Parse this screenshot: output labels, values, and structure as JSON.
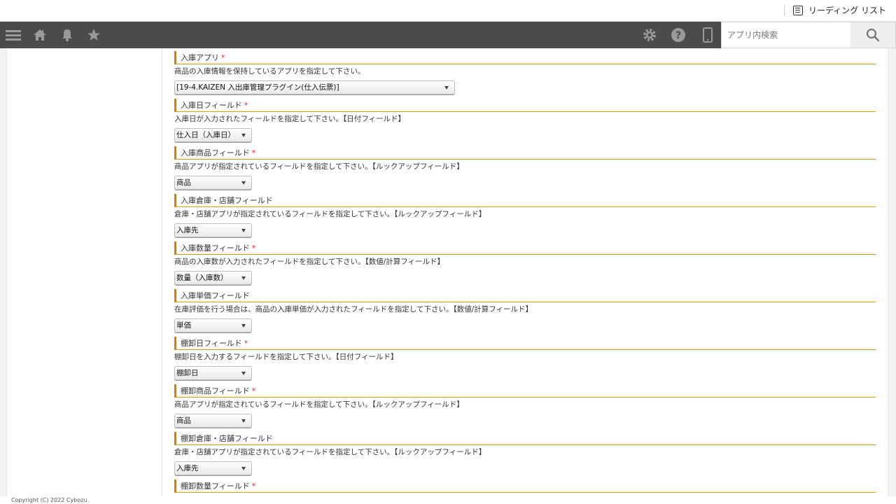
{
  "browser": {
    "reading_list_label": "リーディング リスト"
  },
  "header": {
    "search_placeholder": "アプリ内検索"
  },
  "sections": [
    {
      "title": "入庫アプリ",
      "required": "*",
      "desc": "商品の入庫情報を保持しているアプリを指定して下さい。",
      "value": "[19-4.KAIZEN 入出庫管理プラグイン(仕入伝票)]"
    },
    {
      "title": "入庫日フィールド",
      "required": "*",
      "desc": "入庫日が入力されたフィールドを指定して下さい。【日付フィールド】",
      "value": "仕入日（入庫日）"
    },
    {
      "title": "入庫商品フィールド",
      "required": "*",
      "desc": "商品アプリが指定されているフィールドを指定して下さい。【ルックアップフィールド】",
      "value": "商品"
    },
    {
      "title": "入庫倉庫・店舗フィールド",
      "required": "",
      "desc": "倉庫・店舗アプリが指定されているフィールドを指定して下さい。【ルックアップフィールド】",
      "value": "入庫先"
    },
    {
      "title": "入庫数量フィールド",
      "required": "*",
      "desc": "商品の入庫数が入力されたフィールドを指定して下さい。【数値/計算フィールド】",
      "value": "数量（入庫数）"
    },
    {
      "title": "入庫単価フィールド",
      "required": "",
      "desc": "在庫評価を行う場合は、商品の入庫単価が入力されたフィールドを指定して下さい。【数値/計算フィールド】",
      "value": "単価"
    },
    {
      "title": "棚卸日フィールド",
      "required": "*",
      "desc": "棚卸日を入力するフィールドを指定して下さい。【日付フィールド】",
      "value": "棚卸日"
    },
    {
      "title": "棚卸商品フィールド",
      "required": "*",
      "desc": "商品アプリが指定されているフィールドを指定して下さい。【ルックアップフィールド】",
      "value": "商品"
    },
    {
      "title": "棚卸倉庫・店舗フィールド",
      "required": "",
      "desc": "倉庫・店舗アプリが指定されているフィールドを指定して下さい。【ルックアップフィールド】",
      "value": "入庫先"
    },
    {
      "title": "棚卸数量フィールド",
      "required": "*",
      "desc": "",
      "value": ""
    }
  ],
  "footer": {
    "copyright": "Copyright (C) 2022 Cybozu"
  }
}
